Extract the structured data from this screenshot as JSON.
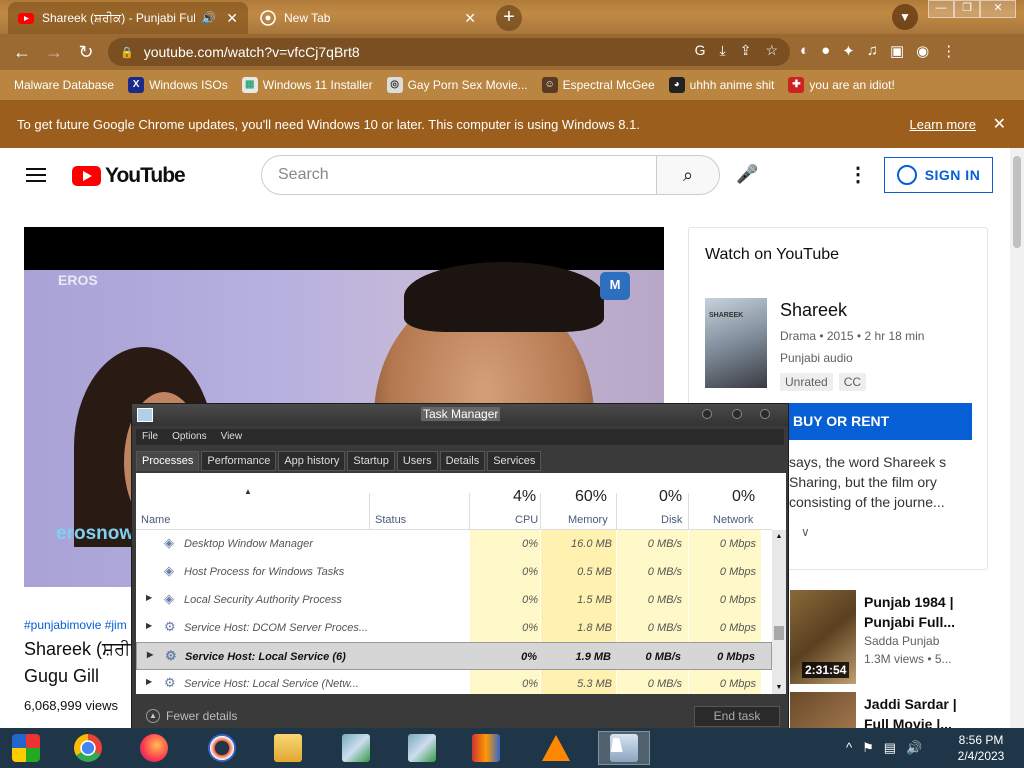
{
  "browser": {
    "tabs": [
      {
        "title": "Shareek (ਸ਼ਰੀਕ) - Punjabi Full",
        "active": true
      },
      {
        "title": "New Tab",
        "active": false
      }
    ],
    "url": "youtube.com/watch?v=vfcCj7qBrt8",
    "bookmarks": [
      {
        "label": "Malware Database",
        "icon": "skull-icon"
      },
      {
        "label": "Windows ISOs",
        "icon": "x-icon"
      },
      {
        "label": "Windows 11 Installer",
        "icon": "image-icon"
      },
      {
        "label": "Gay Porn Sex Movie...",
        "icon": "globe-icon"
      },
      {
        "label": "Espectral McGee",
        "icon": "avatar-icon"
      },
      {
        "label": "uhhh anime shit",
        "icon": "anime-icon"
      },
      {
        "label": "you are an idiot!",
        "icon": "flag-icon"
      }
    ],
    "infobar": {
      "message": "To get future Google Chrome updates, you'll need Windows 10 or later. This computer is using Windows 8.1.",
      "link": "Learn more"
    }
  },
  "youtube": {
    "logo_text": "YouTube",
    "search_placeholder": "Search",
    "sign_in": "SIGN IN",
    "player": {
      "watermark_top": "EROS",
      "watermark_bottom": "erosnow",
      "badge": "M"
    },
    "hashtags": "#punjabimovie #jim",
    "title": "Shareek (ਸ਼ਰੀ Gugu Gill",
    "views": "6,068,999 views",
    "watch_card": {
      "heading": "Watch on YouTube",
      "poster_text": "SHAREEK",
      "movie_title": "Shareek",
      "meta": "Drama • 2015 • 2 hr 18 min",
      "audio": "Punjabi audio",
      "badges": [
        "Unrated",
        "CC"
      ],
      "buy_label": "BUY OR RENT",
      "description": "says, the word Shareek s Sharing, but the film ory consisting of the journe..."
    },
    "recommendations": [
      {
        "title": "Punjab 1984 | Punjabi Full...",
        "channel": "Sadda Punjab",
        "views": "1.3M views  •  5...",
        "duration": "2:31:54"
      },
      {
        "title": "Jaddi Sardar | Full Movie |...",
        "channel": "",
        "views": "",
        "duration": ""
      }
    ]
  },
  "task_manager": {
    "title": "Task Manager",
    "menu": [
      "File",
      "Options",
      "View"
    ],
    "tabs": [
      "Processes",
      "Performance",
      "App history",
      "Startup",
      "Users",
      "Details",
      "Services"
    ],
    "columns": {
      "name": "Name",
      "status": "Status",
      "cpu": {
        "label": "CPU",
        "pct": "4%"
      },
      "memory": {
        "label": "Memory",
        "pct": "60%"
      },
      "disk": {
        "label": "Disk",
        "pct": "0%"
      },
      "network": {
        "label": "Network",
        "pct": "0%"
      }
    },
    "rows": [
      {
        "name": "Desktop Window Manager",
        "cpu": "0%",
        "memory": "16.0 MB",
        "disk": "0 MB/s",
        "network": "0 Mbps",
        "expandable": false,
        "selected": false
      },
      {
        "name": "Host Process for Windows Tasks",
        "cpu": "0%",
        "memory": "0.5 MB",
        "disk": "0 MB/s",
        "network": "0 Mbps",
        "expandable": false,
        "selected": false
      },
      {
        "name": "Local Security Authority Process",
        "cpu": "0%",
        "memory": "1.5 MB",
        "disk": "0 MB/s",
        "network": "0 Mbps",
        "expandable": true,
        "selected": false
      },
      {
        "name": "Service Host: DCOM Server Proces...",
        "cpu": "0%",
        "memory": "1.8 MB",
        "disk": "0 MB/s",
        "network": "0 Mbps",
        "expandable": true,
        "selected": false
      },
      {
        "name": "Service Host: Local Service (6)",
        "cpu": "0%",
        "memory": "1.9 MB",
        "disk": "0 MB/s",
        "network": "0 Mbps",
        "expandable": true,
        "selected": true
      },
      {
        "name": "Service Host: Local Service (Netw...",
        "cpu": "0%",
        "memory": "5.3 MB",
        "disk": "0 MB/s",
        "network": "0 Mbps",
        "expandable": true,
        "selected": false
      }
    ],
    "fewer_details": "Fewer details",
    "end_task": "End task"
  },
  "taskbar": {
    "apps": [
      "windows-start-icon",
      "chrome-icon",
      "firefox-icon",
      "opera-icon",
      "file-explorer-icon",
      "network-install-icon",
      "network-install-icon",
      "winrar-icon",
      "vlc-icon",
      "task-manager-icon"
    ],
    "clock_time": "8:56 PM",
    "clock_date": "2/4/2023"
  },
  "colors": {
    "youtube_red": "#ff0000",
    "youtube_blue": "#065fd4",
    "chrome_theme": "#9a6a32",
    "infobar": "#9c5e1c",
    "taskbar": "#1f3648"
  }
}
